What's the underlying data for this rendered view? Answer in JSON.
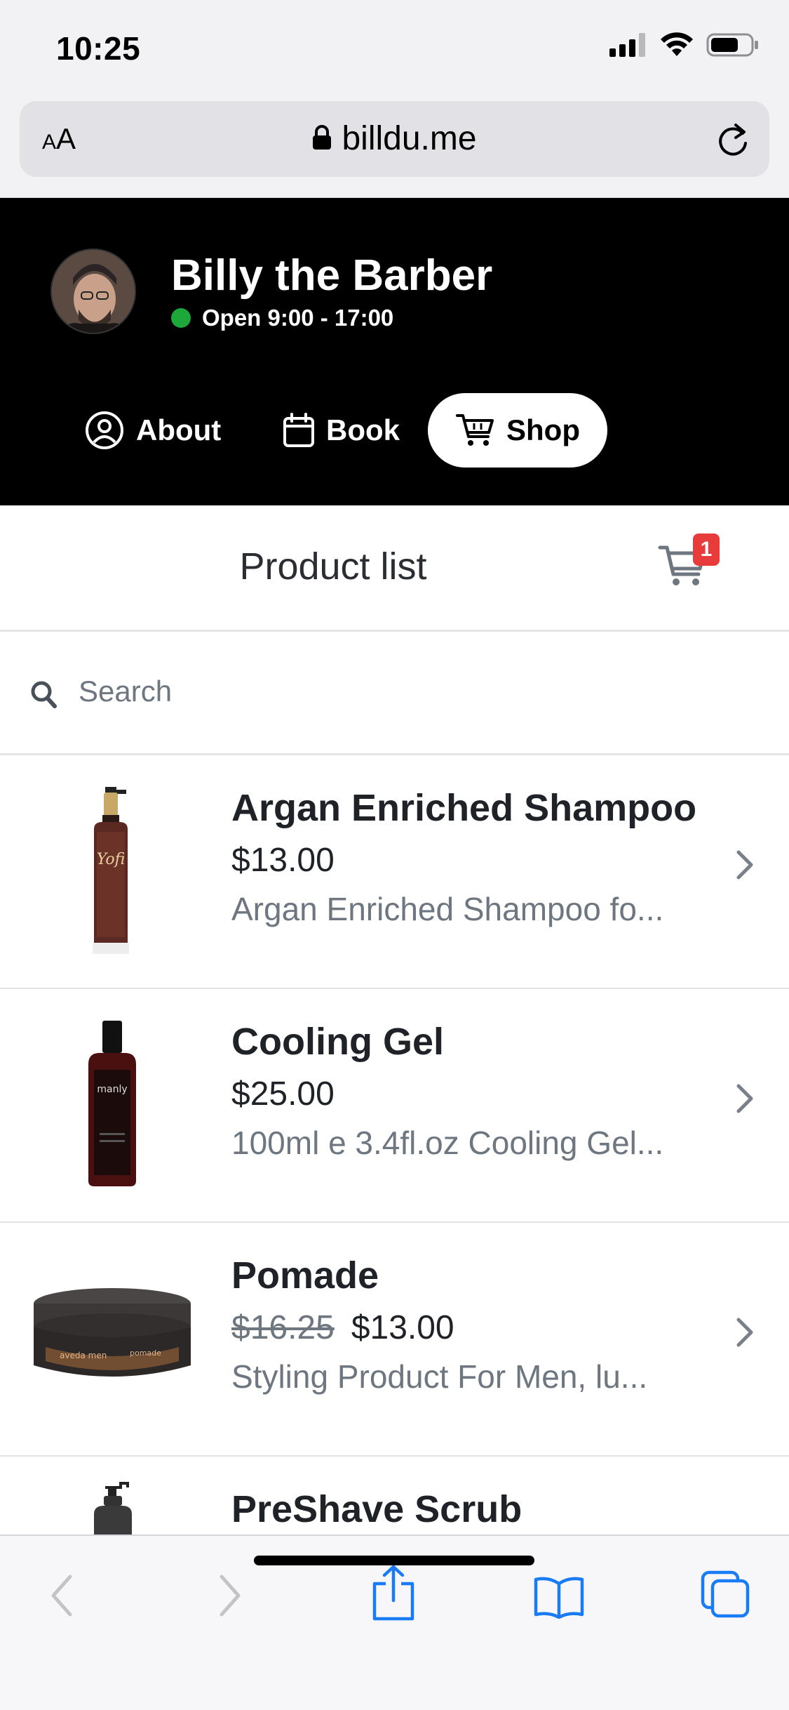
{
  "status_bar": {
    "time": "10:25"
  },
  "browser": {
    "aa_label": "AA",
    "domain": "billdu.me"
  },
  "header": {
    "shop_name": "Billy the Barber",
    "open_status": "Open 9:00 - 17:00",
    "nav": [
      {
        "label": "About",
        "icon": "user-circle-icon"
      },
      {
        "label": "Book",
        "icon": "calendar-icon"
      },
      {
        "label": "Shop",
        "icon": "cart-icon",
        "active": true
      }
    ]
  },
  "list": {
    "title": "Product list",
    "cart_count": "1",
    "search_placeholder": "Search"
  },
  "products": [
    {
      "name": "Argan Enriched Shampoo",
      "price": "$13.00",
      "old_price": "",
      "description": "Argan Enriched Shampoo fo..."
    },
    {
      "name": "Cooling Gel",
      "price": "$25.00",
      "old_price": "",
      "description": "100ml e 3.4fl.oz Cooling Gel..."
    },
    {
      "name": "Pomade",
      "price": "$13.00",
      "old_price": "$16.25",
      "description": "Styling Product For Men, lu..."
    },
    {
      "name": "PreShave Scrub",
      "price": "",
      "old_price": "",
      "description": ""
    }
  ],
  "colors": {
    "header_bg": "#000000",
    "open_dot": "#1ea83a",
    "badge": "#e83b3b",
    "ios_blue": "#1a7cf4"
  }
}
